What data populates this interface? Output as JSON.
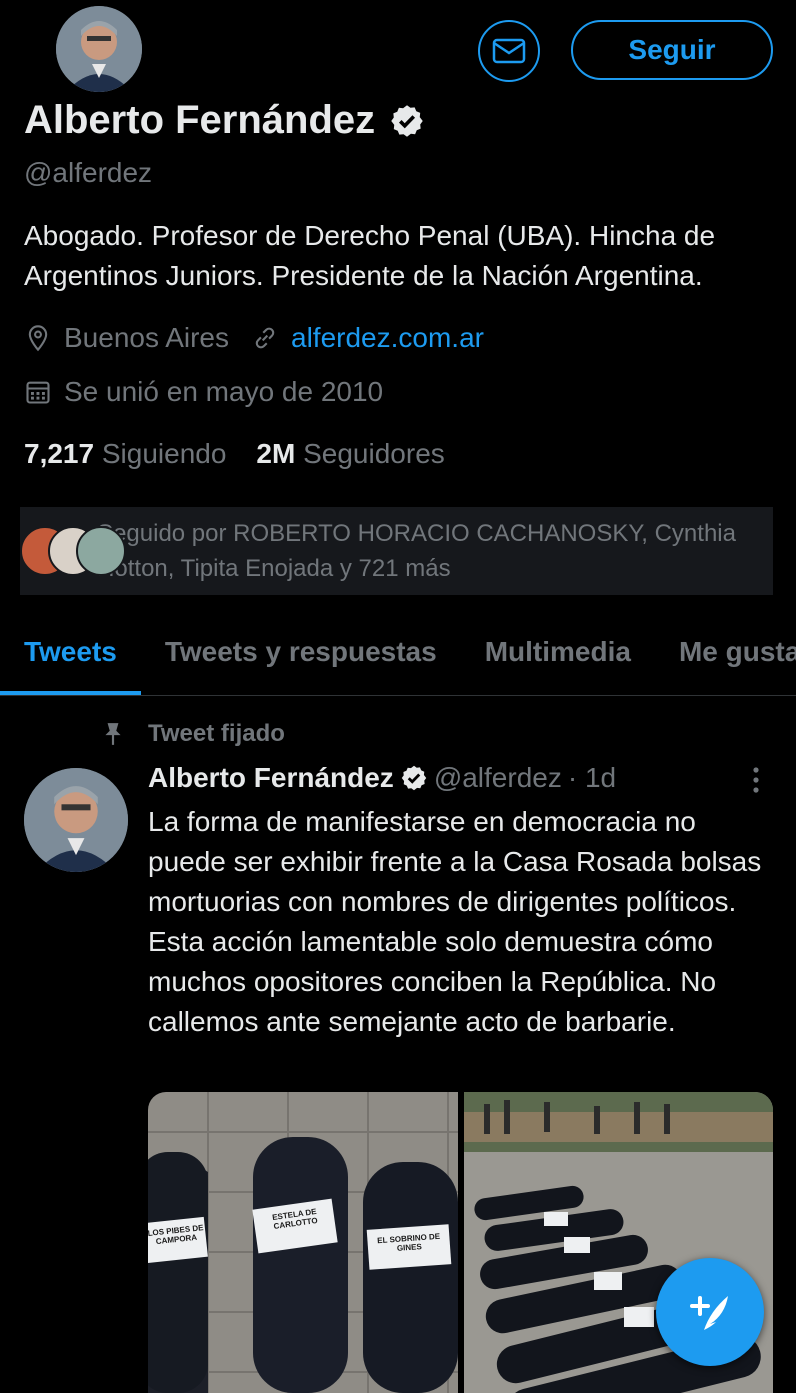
{
  "profile": {
    "name": "Alberto Fernández",
    "handle": "@alferdez",
    "bio": "Abogado. Profesor de Derecho Penal (UBA). Hincha de Argentinos Juniors. Presidente de la Nación Argentina.",
    "location": "Buenos Aires",
    "website": "alferdez.com.ar",
    "joined": "Se unió en mayo de 2010",
    "following_count": "7,217",
    "following_label": "Siguiendo",
    "followers_count": "2M",
    "followers_label": "Seguidores",
    "followed_by": "Seguido por ROBERTO HORACIO CACHANOSKY, Cynthia Hotton, Tipita Enojada y 721 más"
  },
  "actions": {
    "message_icon": "envelope-icon",
    "follow_label": "Seguir"
  },
  "tabs": [
    {
      "label": "Tweets"
    },
    {
      "label": "Tweets y respuestas"
    },
    {
      "label": "Multimedia"
    },
    {
      "label": "Me gusta"
    }
  ],
  "pinned_tweet": {
    "pinned_label": "Tweet fijado",
    "author_name": "Alberto Fernández",
    "author_handle": "@alferdez",
    "time": "· 1d",
    "text": "La forma de manifestarse en democracia no puede ser exhibir frente a la Casa Rosada bolsas mortuorias con nombres de dirigentes políticos. Esta acción lamentable solo demuestra cómo muchos opositores conciben la República. No callemos ante semejante acto de barbarie.",
    "photo1_labels": [
      "ESTELA DE CARLOTTO",
      "LOS PIBES DE CAMPORA",
      "EL SOBRINO DE GINES"
    ]
  },
  "colors": {
    "accent": "#1d9bf0",
    "background": "#000000",
    "text_primary": "#e7e9ea",
    "text_secondary": "#71767b"
  },
  "icons": {
    "verified": "verified-badge-icon",
    "location": "location-pin-icon",
    "link": "link-icon",
    "calendar": "calendar-icon",
    "pin": "pin-icon",
    "more": "more-vertical-icon",
    "compose": "compose-tweet-icon"
  }
}
